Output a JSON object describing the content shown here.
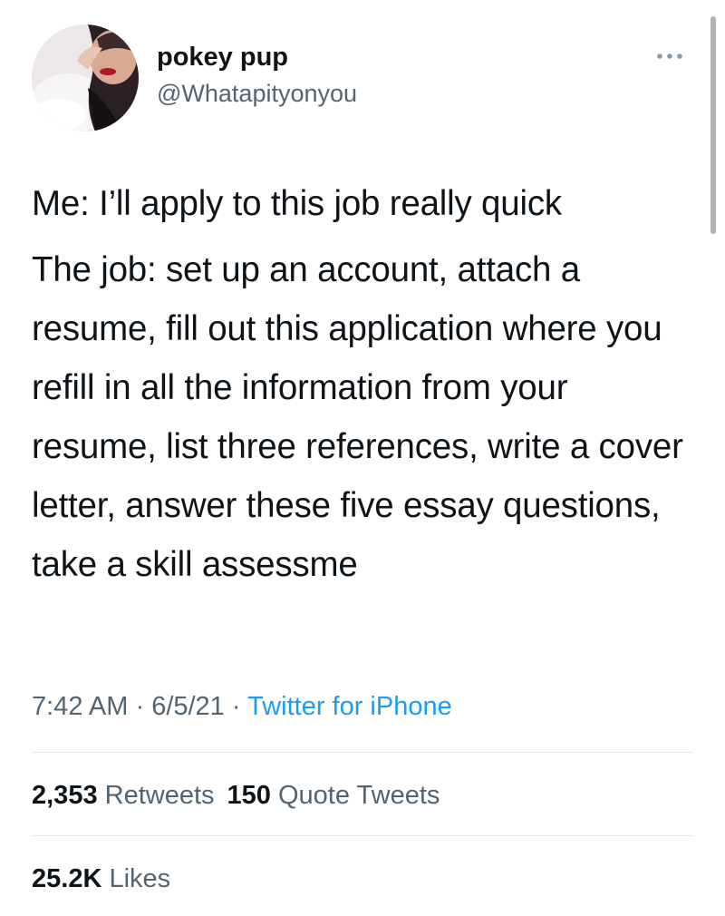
{
  "author": {
    "display_name": "pokey pup",
    "handle": "@Whatapityonyou"
  },
  "menu": {
    "icon": "more-horizontal-icon"
  },
  "tweet": {
    "line_1": "Me: I’ll apply to this job really quick",
    "line_2": "The job: set up an account, attach a resume, fill out this application where you refill in all the information from your resume, list three references, write a cover letter, answer these five essay questions, take a skill assessme"
  },
  "meta": {
    "time": "7:42 AM",
    "separator_1": " · ",
    "date": "6/5/21",
    "separator_2": " · ",
    "source": "Twitter for iPhone"
  },
  "stats": {
    "retweets_count": "2,353",
    "retweets_label": "Retweets",
    "quotes_count": "150",
    "quotes_label": "Quote Tweets",
    "likes_count": "25.2K",
    "likes_label": "Likes"
  },
  "colors": {
    "text": "#0f1419",
    "secondary": "#536471",
    "link": "#1d9bf0",
    "divider": "#e1e6ea"
  }
}
